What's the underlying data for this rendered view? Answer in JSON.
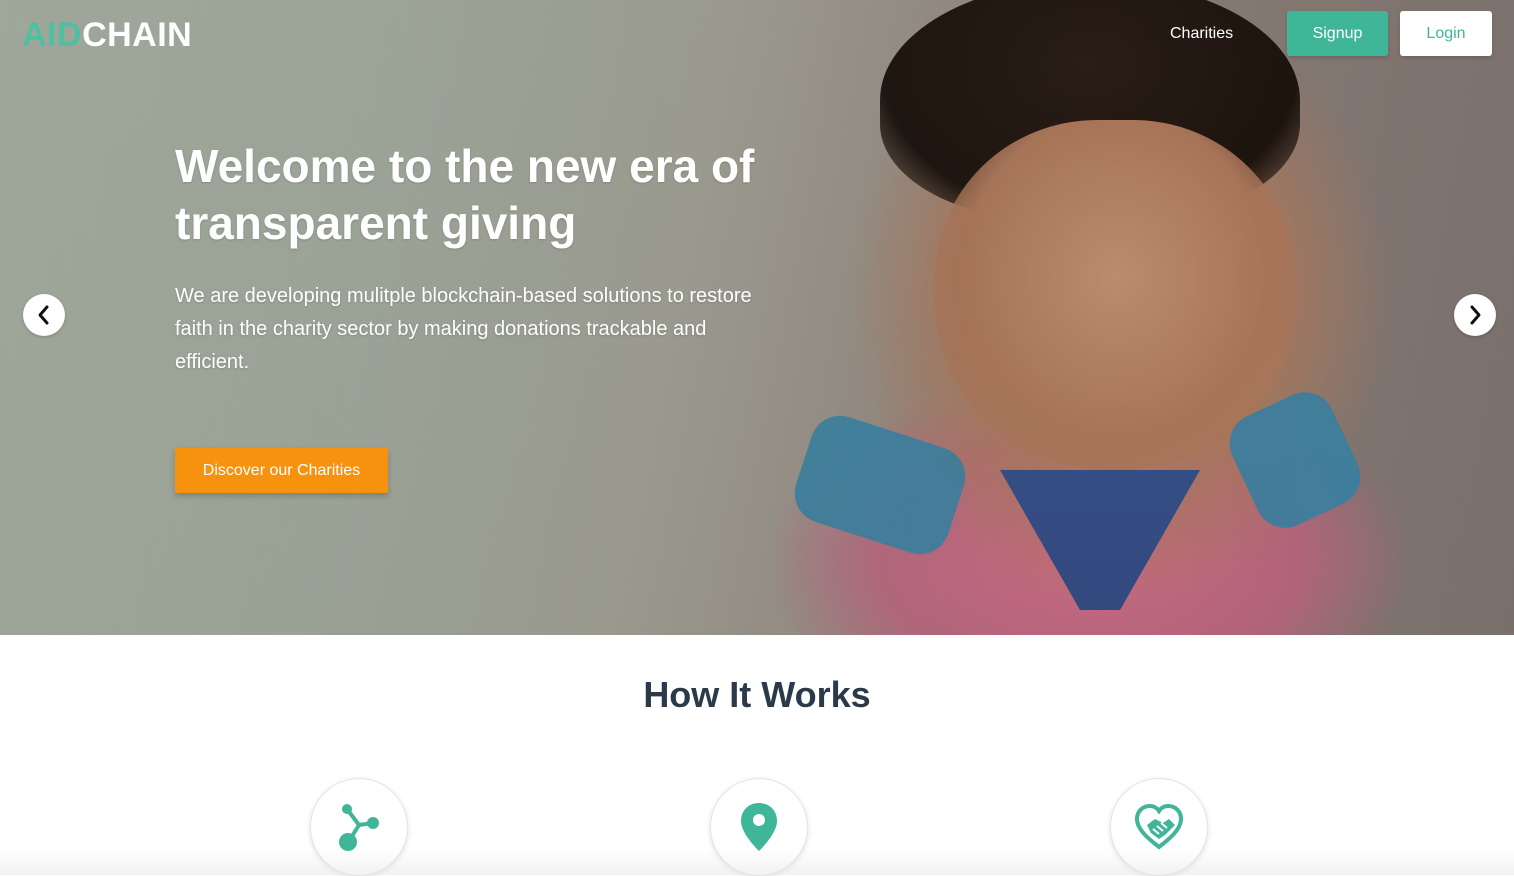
{
  "header": {
    "logo": {
      "part1": "AID",
      "part2": "CHAIN"
    },
    "nav": {
      "charities": "Charities"
    },
    "signup_label": "Signup",
    "login_label": "Login"
  },
  "hero": {
    "title": "Welcome to the new era of transparent giving",
    "subtitle": "We are developing mulitple blockchain-based solutions to restore faith in the charity sector by making donations trackable and efficient.",
    "cta_label": "Discover our Charities",
    "prev_icon": "chevron-left-icon",
    "next_icon": "chevron-right-icon"
  },
  "how_it_works": {
    "title": "How It Works",
    "steps": [
      {
        "icon": "share-nodes-icon"
      },
      {
        "icon": "map-pin-icon"
      },
      {
        "icon": "heart-handshake-icon"
      }
    ]
  },
  "colors": {
    "brand_teal": "#3fb698",
    "cta_orange": "#f7920f",
    "heading_dark": "#2a3a4a"
  }
}
